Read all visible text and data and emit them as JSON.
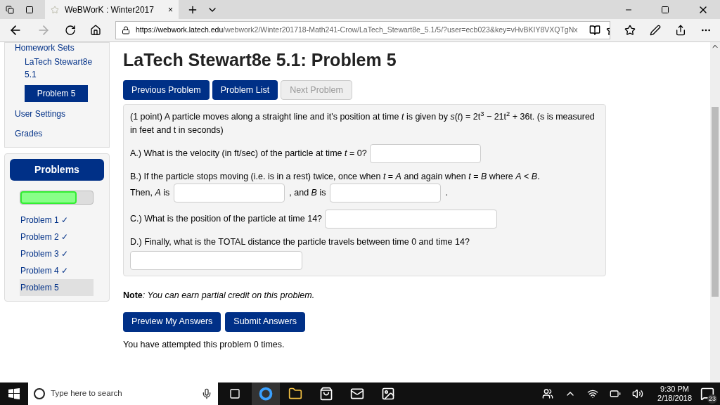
{
  "browser": {
    "tab": {
      "title": "WeBWorK : Winter2017",
      "close": "×"
    },
    "address": {
      "host": "https://webwork.latech.edu",
      "path": "/webwork2/Winter201718-Math241-Crow/LaTech_Stewart8e_5.1/5/?user=ecb023&key=vHvBKIY8VXQTgNx"
    }
  },
  "sidebar": {
    "heading": "Homework Sets",
    "set": "LaTech Stewart8e 5.1",
    "current": "Problem 5",
    "links": [
      "User Settings",
      "Grades"
    ],
    "problems": {
      "title": "Problems",
      "level": 0.78,
      "items": [
        {
          "label": "Problem 1 ✓",
          "selected": false
        },
        {
          "label": "Problem 2 ✓",
          "selected": false
        },
        {
          "label": "Problem 3 ✓",
          "selected": false
        },
        {
          "label": "Problem 4 ✓",
          "selected": false
        },
        {
          "label": "Problem 5",
          "selected": true
        }
      ]
    }
  },
  "main": {
    "title": "LaTech Stewart8e 5.1: Problem 5",
    "nav": [
      {
        "label": "Previous Problem",
        "disabled": false
      },
      {
        "label": "Problem List",
        "disabled": false
      },
      {
        "label": "Next Problem",
        "disabled": true
      }
    ],
    "intro": "(1 point) A particle moves along a straight line and it's position at time *t* is given by *s*(*t*) = 2t$^{3}$ − 21t$^{2}$ + 36t. (s is measured in feet and t in seconds)",
    "a": "A.) What is the velocity (in ft/sec) of the particle at time *t* = 0?",
    "b": "B.) If the particle stops moving (i.e. is in a rest) twice, once when *t* = *A* and again when *t* = *B* where *A* < *B*.",
    "b_then": "Then, *A* is",
    "b_and": ", and *B* is",
    "b_end": ".",
    "c": "C.) What is the position of the particle at time 14?",
    "d": "D.) Finally, what is the TOTAL distance the particle travels between time 0 and time 14?",
    "note_label": "Note",
    "note": ": You can earn partial credit on this problem.",
    "actions": [
      "Preview My Answers",
      "Submit Answers"
    ],
    "attempts": "You have attempted this problem 0 times."
  },
  "taskbar": {
    "search": {
      "placeholder": "Type here to search"
    },
    "time": "9:30 PM",
    "date": "2/18/2018",
    "notifications": "23"
  }
}
